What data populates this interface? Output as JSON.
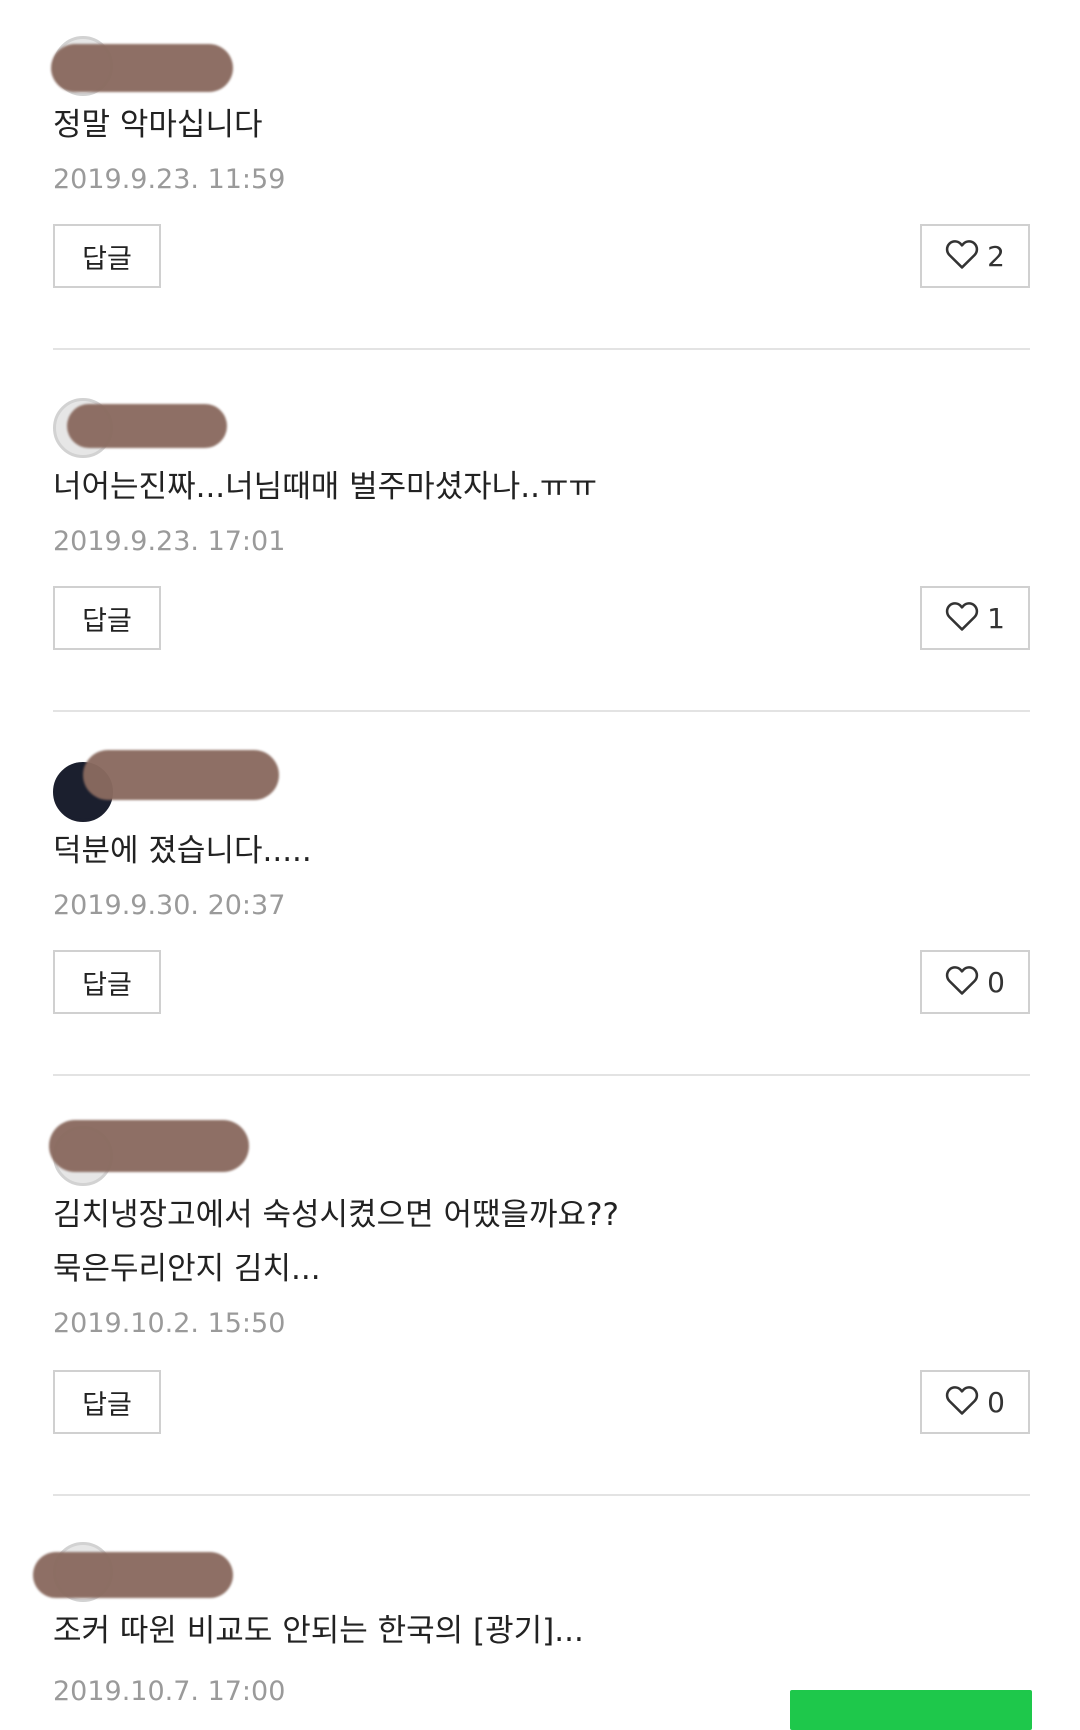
{
  "comments": [
    {
      "text": "정말 악마십니다",
      "lines": [
        "정말 악마십니다"
      ],
      "timestamp": "2019.9.23. 11:59",
      "reply_label": "답글",
      "likes": "2"
    },
    {
      "text": "너어는진짜...너님때매 벌주마셨자나..ㅠㅠ",
      "lines": [
        "너어는진짜...너님때매 벌주마셨자나..ㅠㅠ"
      ],
      "timestamp": "2019.9.23. 17:01",
      "reply_label": "답글",
      "likes": "1"
    },
    {
      "text": "덕분에 졌습니다.....",
      "lines": [
        "덕분에 졌습니다....."
      ],
      "timestamp": "2019.9.30. 20:37",
      "reply_label": "답글",
      "likes": "0"
    },
    {
      "text": "김치냉장고에서 숙성시켰으면 어땠을까요?? 묵은두리안지 김치...",
      "lines": [
        "김치냉장고에서 숙성시켰으면 어땠을까요??",
        "묵은두리안지 김치..."
      ],
      "timestamp": "2019.10.2. 15:50",
      "reply_label": "답글",
      "likes": "0"
    },
    {
      "text": "조커 따윈 비교도 안되는 한국의 [광기]...",
      "lines": [
        "조커 따윈 비교도 안되는 한국의 [광기]..."
      ],
      "timestamp": "2019.10.7. 17:00"
    }
  ],
  "icons": {
    "like": "heart-outline-icon"
  },
  "colors": {
    "timestamp": "#9a9a9a",
    "redaction": "#8a6a5f",
    "green_button": "#1ec84b"
  }
}
